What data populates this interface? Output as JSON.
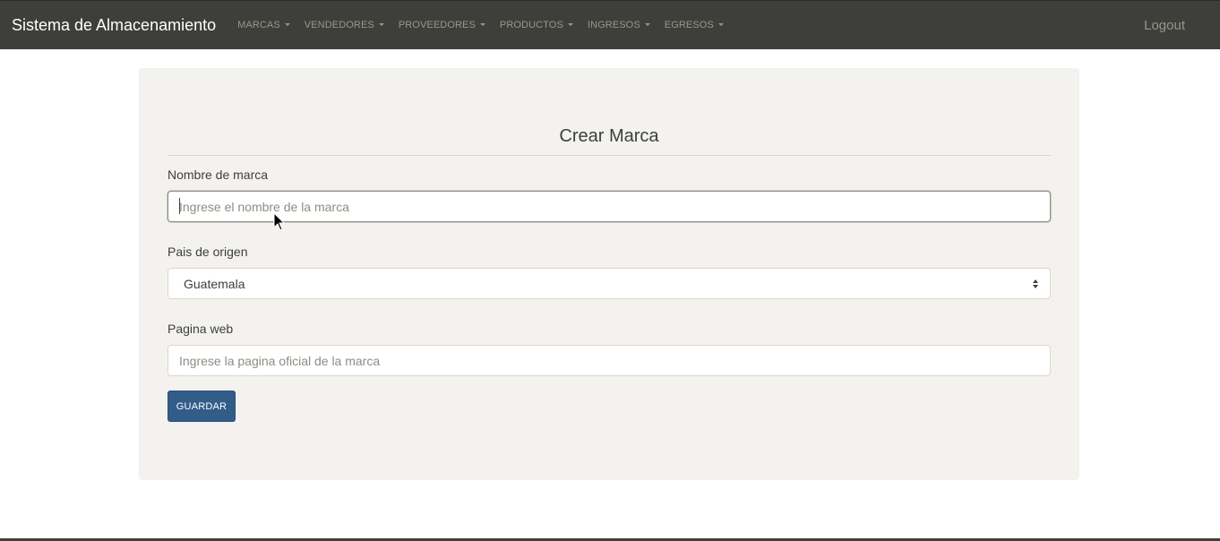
{
  "navbar": {
    "brand": "Sistema de Almacenamiento",
    "menu": [
      {
        "label": "MARCAS"
      },
      {
        "label": "VENDEDORES"
      },
      {
        "label": "PROVEEDORES"
      },
      {
        "label": "PRODUCTOS"
      },
      {
        "label": "INGRESOS"
      },
      {
        "label": "EGRESOS"
      }
    ],
    "logout_label": "Logout"
  },
  "form": {
    "title": "Crear Marca",
    "brand_name": {
      "label": "Nombre de marca",
      "placeholder": "Ingrese el nombre de la marca",
      "value": ""
    },
    "country": {
      "label": "Pais de origen",
      "selected": "Guatemala"
    },
    "website": {
      "label": "Pagina web",
      "placeholder": "Ingrese la pagina oficial de la marca",
      "value": ""
    },
    "submit_label": "GUARDAR"
  },
  "colors": {
    "navbar_bg": "#3e3f3a",
    "card_bg": "#f3f2ee",
    "primary_button": "#325d88",
    "nav_text": "#98978b"
  },
  "icons": {
    "dropdown_caret": "caret-down-icon",
    "select_arrows": "sort-arrows-icon",
    "mouse_pointer": "mouse-cursor-icon"
  }
}
